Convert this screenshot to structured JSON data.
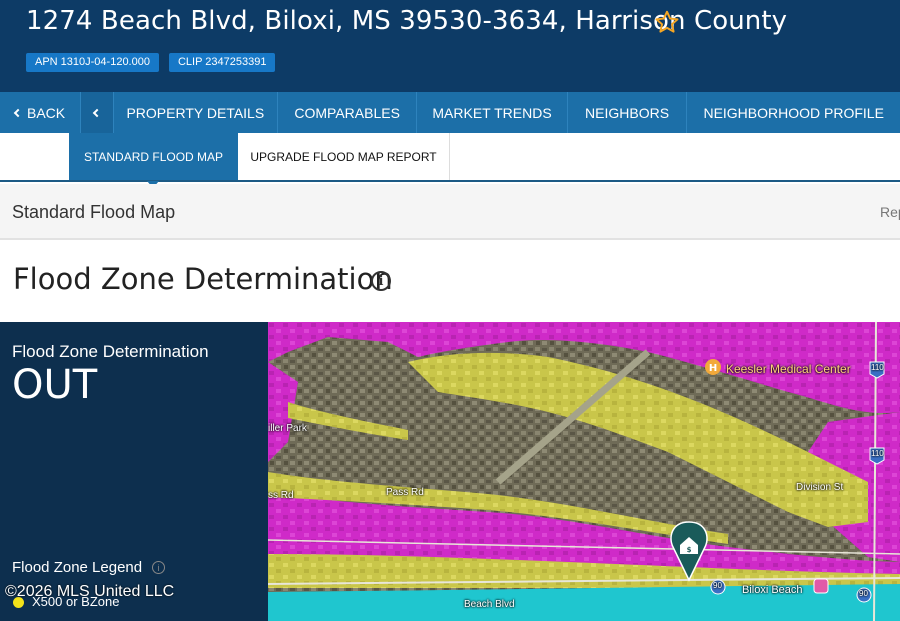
{
  "header": {
    "address": "1274 Beach Blvd, Biloxi, MS 39530-3634, Harrison County",
    "badges": [
      "APN 1310J-04-120.000",
      "CLIP 2347253391"
    ]
  },
  "nav": {
    "back": "BACK",
    "items": [
      "PROPERTY DETAILS",
      "COMPARABLES",
      "MARKET TRENDS",
      "NEIGHBORS",
      "NEIGHBORHOOD PROFILE"
    ]
  },
  "subtabs": {
    "active": "STANDARD FLOOD MAP",
    "upgrade": "UPGRADE FLOOD MAP REPORT"
  },
  "section": {
    "title": "Standard Flood Map",
    "right_partial": "Rep"
  },
  "flood": {
    "heading": "Flood Zone Determination",
    "panel_label": "Flood Zone Determination",
    "status": "OUT",
    "legend_title": "Flood Zone Legend",
    "legend_item": "X500 or BZone",
    "copyright": "©2026 MLS United LLC"
  },
  "map": {
    "labels": {
      "hospital": "Keesler Medical Center",
      "park": "iller Park",
      "pass_rd_1": "ss Rd",
      "pass_rd_2": "Pass Rd",
      "division": "Division St",
      "beach_blvd": "Beach Blvd",
      "biloxi_beach": "Biloxi Beach",
      "hwy_110": "110",
      "hwy_90": "90",
      "hwy_90b": "90"
    },
    "colors": {
      "zone_ae": "#d82ad2",
      "zone_x500": "#d8d64a",
      "zone_ve": "#1fc6cf",
      "land": "#6e6a55"
    }
  }
}
